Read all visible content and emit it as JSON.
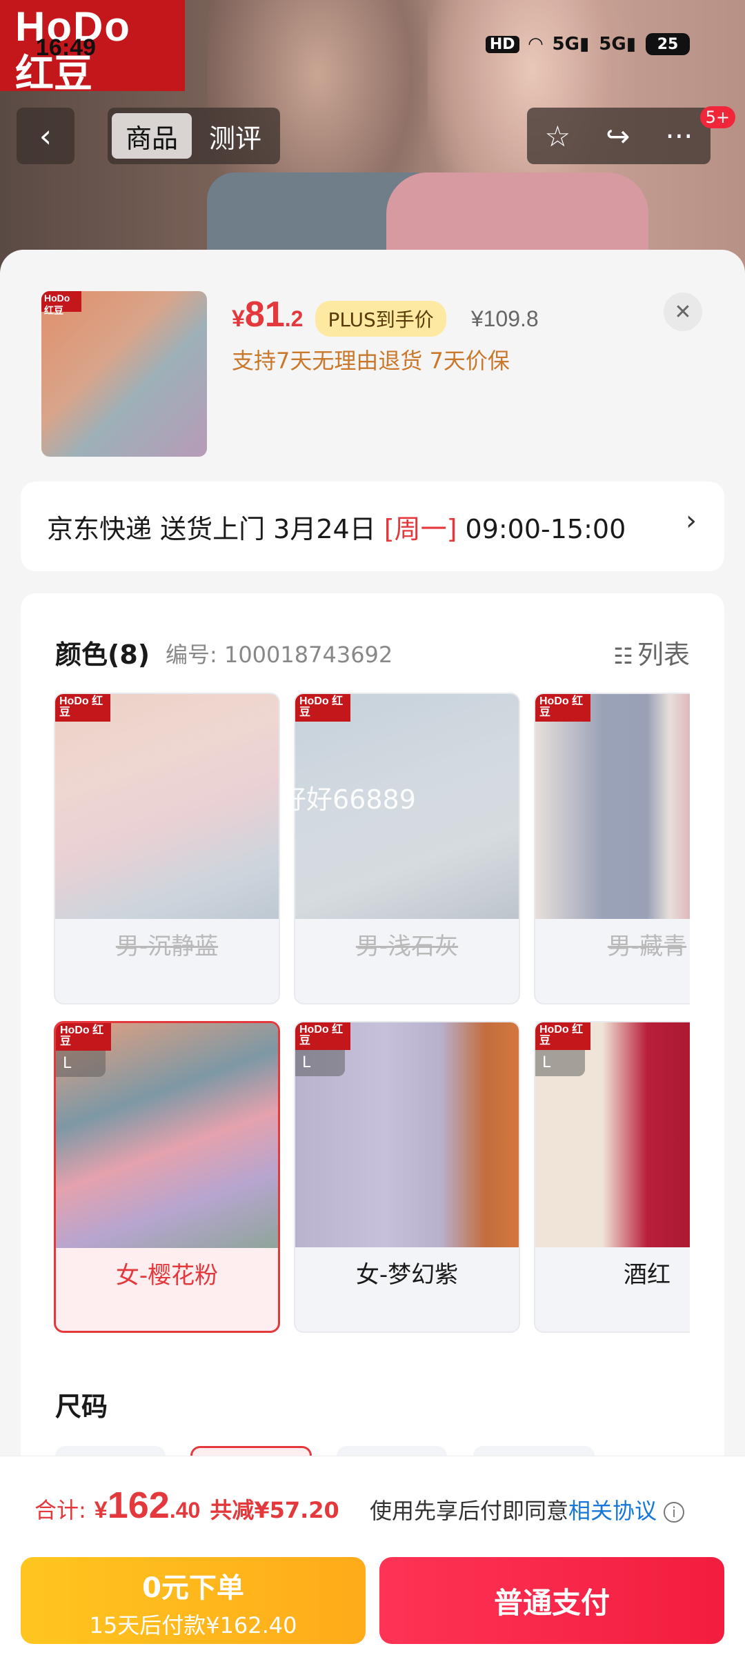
{
  "status_bar": {
    "time": "16:49",
    "hd": "HD",
    "signal1": "5G",
    "signal2": "5G",
    "battery": "25"
  },
  "hero": {
    "brand_line1": "HoDo",
    "brand_line2": "红豆"
  },
  "nav": {
    "back_icon": "‹",
    "tabs": [
      {
        "label": "商品",
        "active": true
      },
      {
        "label": "测评",
        "active": false
      }
    ],
    "message_badge": "5+"
  },
  "product": {
    "price_currency": "¥",
    "price_int": "81",
    "price_dec": ".2",
    "plus_badge": "PLUS到手价",
    "original_price": "¥109.8",
    "promo": "支持7天无理由退货  7天价保",
    "thumb_tag": "HoDo 红豆"
  },
  "delivery": {
    "prefix": "京东快递 送货上门 3月24日 ",
    "highlight": "[周一]",
    "suffix": " 09:00-15:00",
    "arrow": "›"
  },
  "color_section": {
    "title": "颜色(8)",
    "sku": "编号: 100018743692",
    "list_label": "列表",
    "watermark": "好好66889",
    "items": [
      {
        "label": "男-沉静蓝",
        "tag": "HoDo 红豆",
        "state": "disabled"
      },
      {
        "label": "男-浅石灰",
        "tag": "HoDo 红豆",
        "state": "disabled"
      },
      {
        "label": "男-藏青",
        "tag": "HoDo 红豆",
        "state": "disabled"
      },
      {
        "label": "女-樱花粉",
        "tag": "HoDo 红豆",
        "size": "L",
        "state": "selected"
      },
      {
        "label": "女-梦幻紫",
        "tag": "HoDo 红豆",
        "size": "L",
        "state": "normal"
      },
      {
        "label": "酒红",
        "tag": "HoDo 红豆",
        "size": "L",
        "state": "normal"
      }
    ]
  },
  "size_section": {
    "title": "尺码"
  },
  "bottom": {
    "total_label": "合计: ",
    "total_currency": "¥",
    "total_int": "162",
    "total_dec": ".40",
    "saved": "共减¥57.20",
    "agree_text": "使用先享后付即同意",
    "agree_link": "相关协议",
    "info_icon": "i",
    "btn_later_title": "0元下单",
    "btn_later_sub": "15天后付款¥162.40",
    "btn_pay": "普通支付"
  },
  "colors": {
    "accent_red": "#e4393c",
    "pay_red": "#f21d3f",
    "later_yellow": "#ffc51f",
    "brand_red": "#c4171c",
    "link_blue": "#1677d8"
  }
}
